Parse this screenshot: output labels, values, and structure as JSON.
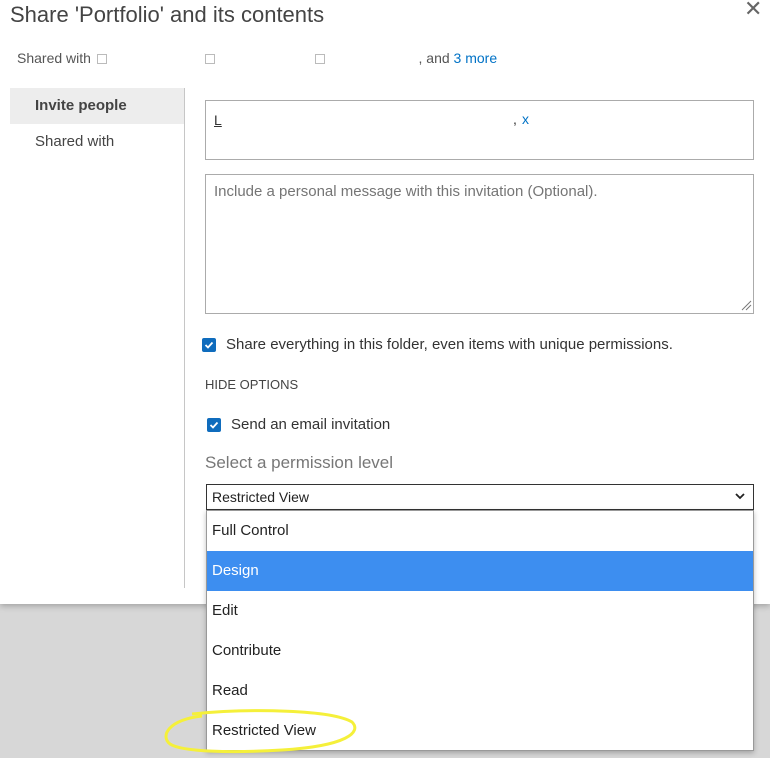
{
  "dialog": {
    "title": "Share 'Portfolio' and its contents",
    "shared_with_prefix": "Shared with",
    "shared_with_tail": ", and",
    "more_link": "3 more"
  },
  "nav": {
    "items": [
      {
        "label": "Invite people",
        "active": true
      },
      {
        "label": "Shared with",
        "active": false
      }
    ]
  },
  "invite": {
    "person_initial": "L",
    "remove_label": "x",
    "message_placeholder": "Include a personal message with this invitation (Optional).",
    "share_everything_label": "Share everything in this folder, even items with unique permissions.",
    "share_everything_checked": true,
    "hide_options_label": "HIDE OPTIONS",
    "send_email_label": "Send an email invitation",
    "send_email_checked": true,
    "permission_label": "Select a permission level",
    "permission_selected": "Restricted View",
    "permission_options": [
      "Full Control",
      "Design",
      "Edit",
      "Contribute",
      "Read",
      "Restricted View"
    ],
    "highlighted_option": "Design"
  },
  "colors": {
    "accent": "#0f6cbd",
    "option_highlight": "#3d8ef0",
    "annotation": "#f5f03a"
  }
}
